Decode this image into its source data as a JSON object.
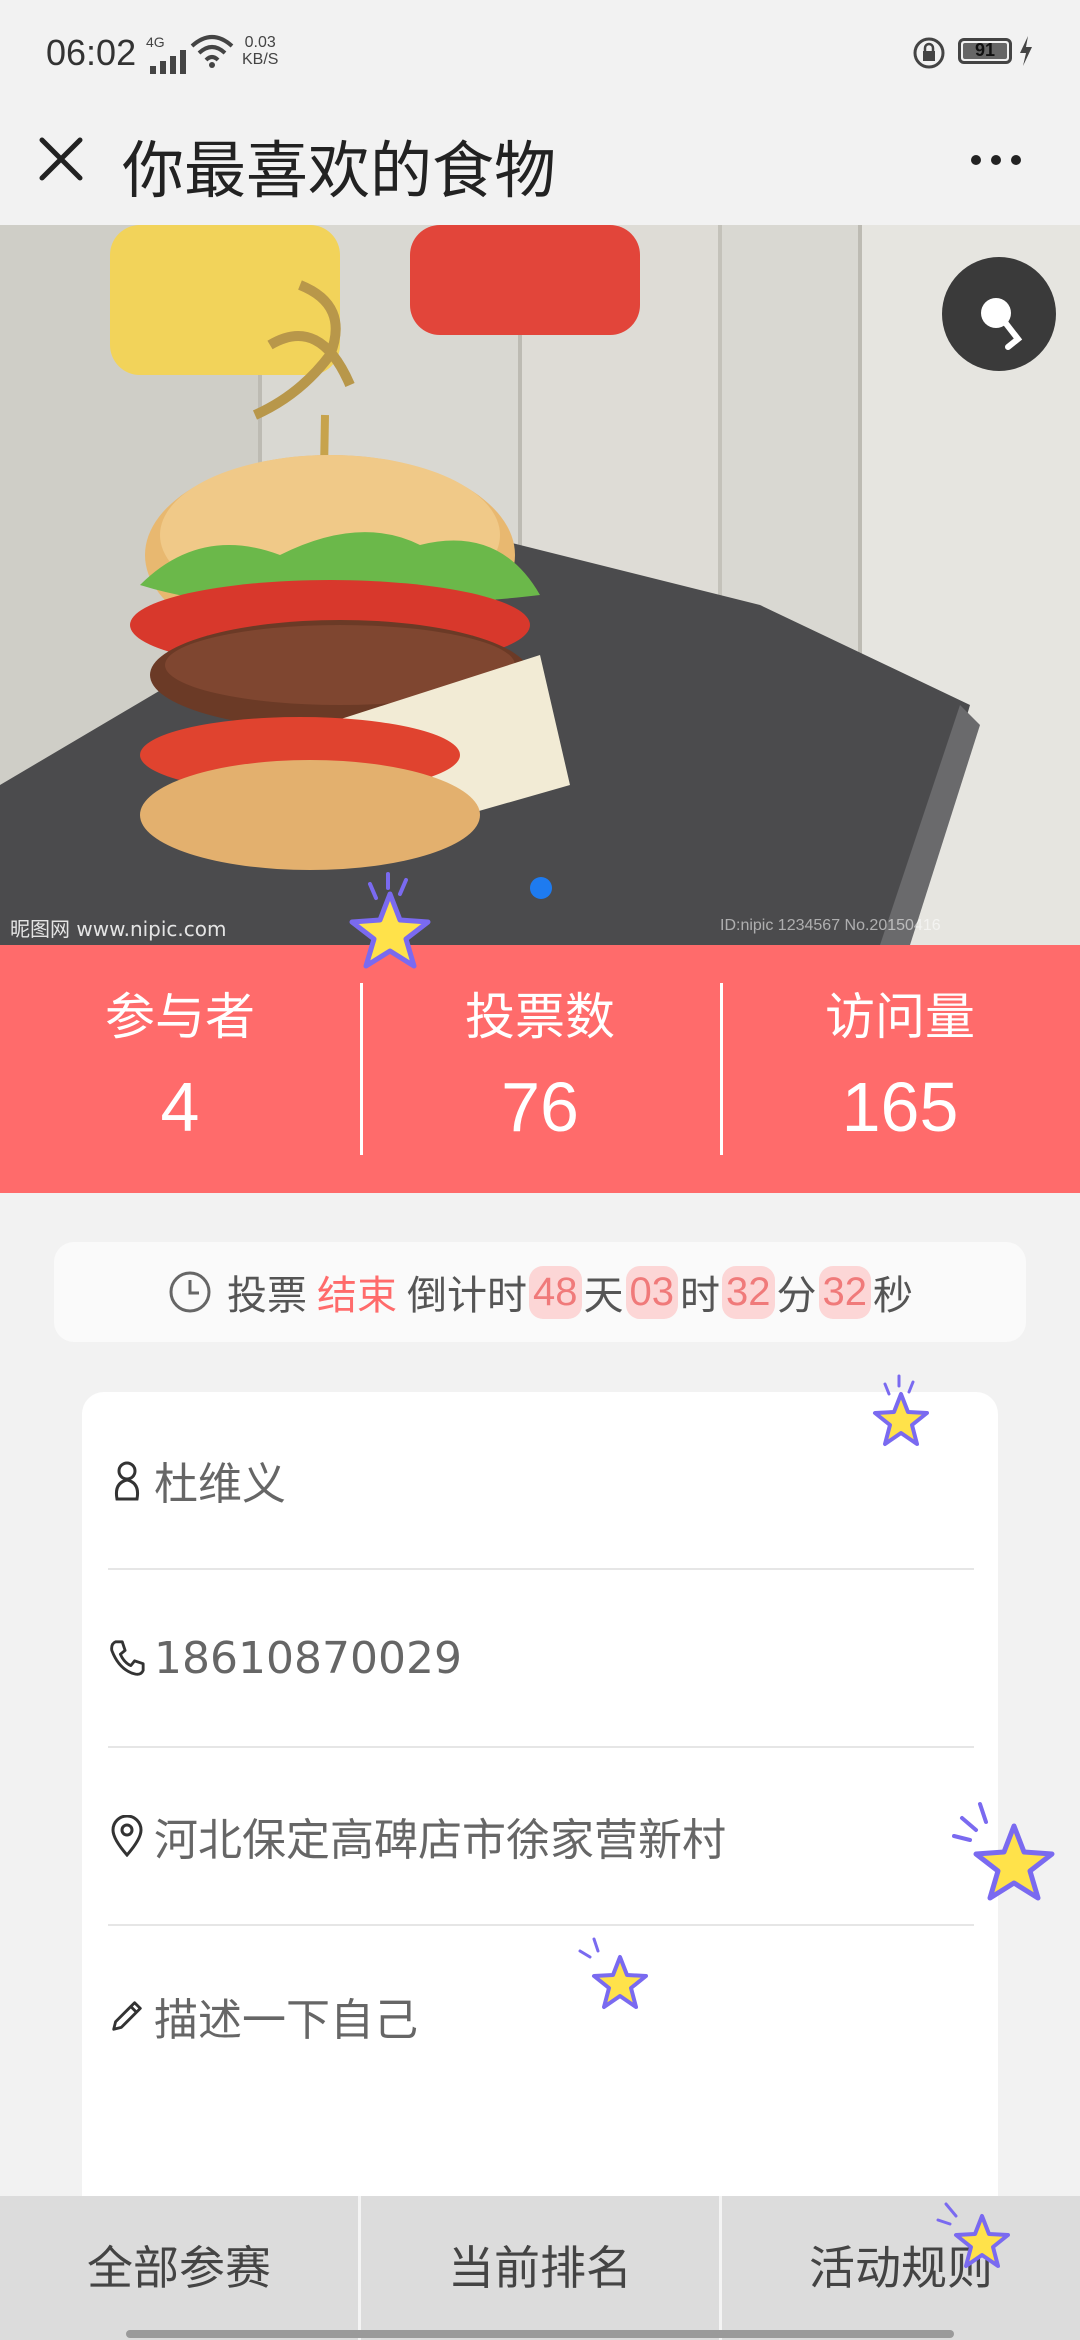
{
  "status_bar": {
    "time": "06:02",
    "network_type": "4G",
    "net_speed_value": "0.03",
    "net_speed_unit": "KB/S",
    "battery": "91"
  },
  "nav": {
    "title": "你最喜欢的食物"
  },
  "banner": {
    "watermark": "昵图网 www.nipic.com",
    "active_slide": 1,
    "slide_count": 1
  },
  "stats": [
    {
      "label": "参与者",
      "value": "4"
    },
    {
      "label": "投票数",
      "value": "76"
    },
    {
      "label": "访问量",
      "value": "165"
    }
  ],
  "countdown": {
    "prefix": "投票",
    "status": "结束",
    "mid": "倒计时",
    "days": "48",
    "days_unit": "天",
    "hours": "03",
    "hours_unit": "时",
    "minutes": "32",
    "minutes_unit": "分",
    "seconds": "32",
    "seconds_unit": "秒"
  },
  "form": {
    "name": "杜维义",
    "phone": "18610870029",
    "address": "河北保定高碑店市徐家营新村",
    "description_placeholder": "描述一下自己"
  },
  "tabbar": {
    "all": "全部参赛",
    "ranking": "当前排名",
    "rules": "活动规则"
  },
  "colors": {
    "accent": "#ff6b6b",
    "countdown_chip": "#fcd6d6",
    "dot_active": "#1e7bf0"
  }
}
